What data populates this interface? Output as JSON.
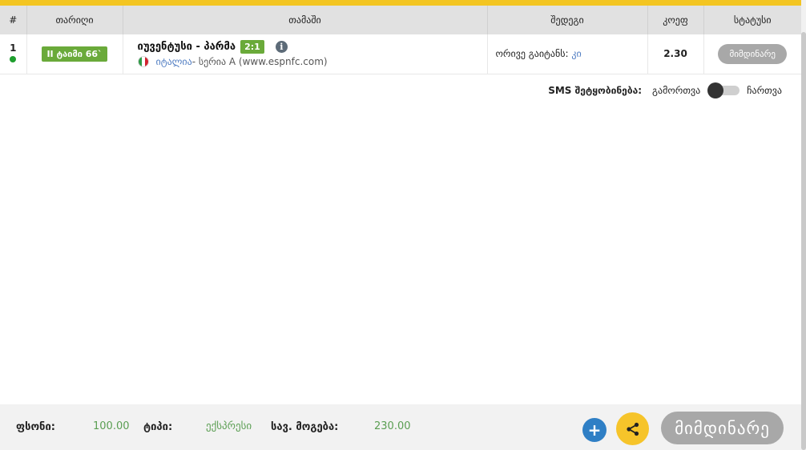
{
  "colors": {
    "accent_yellow": "#f3c522",
    "header_bg": "#e1e1e1",
    "badge_green": "#6aaa3a",
    "link_blue": "#4f7cc2",
    "value_green": "#5a9e52",
    "status_gray": "#a8a8a8",
    "live_dot": "#1e9e2e",
    "plus_blue": "#2f7fc5",
    "share_yellow": "#f6c42a"
  },
  "table": {
    "headers": {
      "num": "#",
      "date": "თარიღი",
      "game": "თამაში",
      "event": "შედეგი",
      "odds": "კოეფ",
      "status": "სტატუსი"
    },
    "rows": [
      {
        "num": "1",
        "live": true,
        "period": "II ტაიმი 66`",
        "teams": "იუვენტუსი - პარმა",
        "score": "2:1",
        "info_icon": "info-icon",
        "flag": "italy-flag-icon",
        "country": "იტალია",
        "league": " - სერია A (www.espnfc.com)",
        "event_label": "ორივე გაიტანს: ",
        "event_pick": "კი",
        "odds": "2.30",
        "status": "მიმდინარე"
      }
    ]
  },
  "sms": {
    "label": "SMS შეტყობინება:",
    "off_label": "გამორთვა",
    "on_label": "ჩართვა",
    "state": "off"
  },
  "footer": {
    "stake_label": "ფსონი:",
    "stake_value": "100.00",
    "type_label": "ტიპი:",
    "type_value": "ექსპრესი",
    "win_label": "სავ. მოგება:",
    "win_value": "230.00",
    "add_icon": "plus-icon",
    "share_icon": "share-icon",
    "status_button": "მიმდინარე"
  }
}
